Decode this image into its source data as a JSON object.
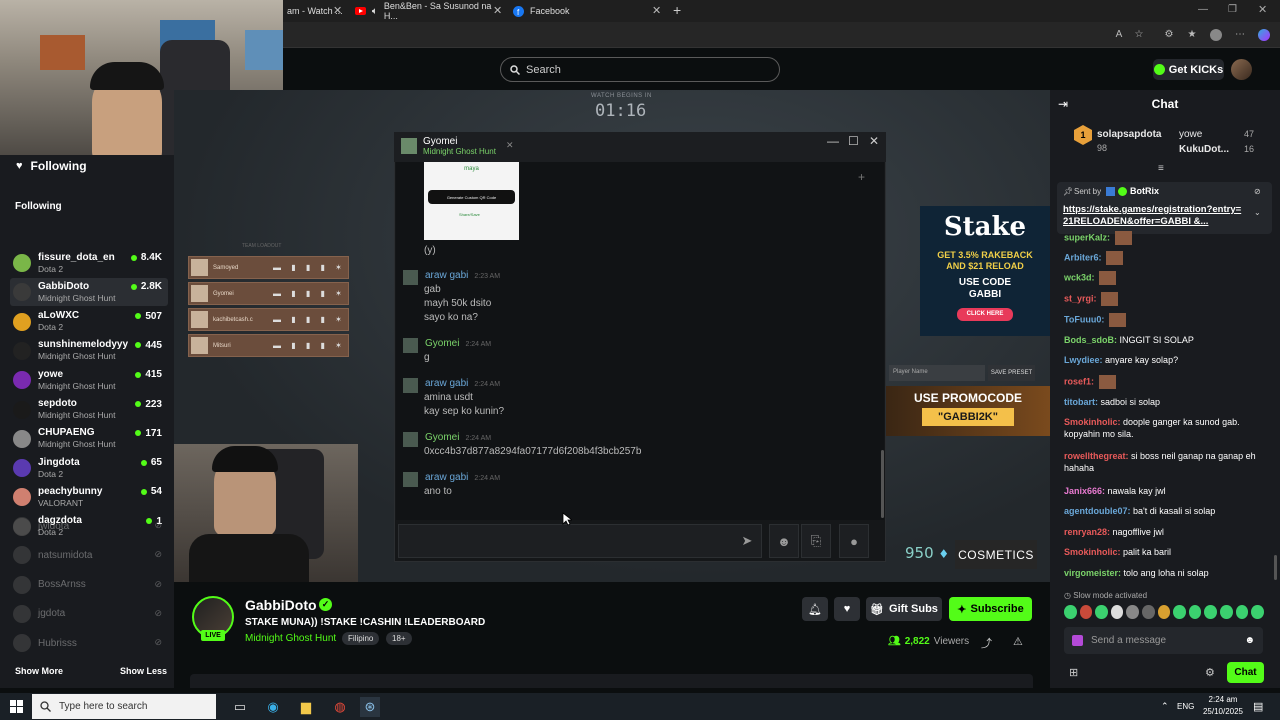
{
  "browser": {
    "tabs": [
      {
        "label": "am - Watch ...",
        "icon": "kick-icon"
      },
      {
        "label": "Ben&Ben - Sa Susunod na H...",
        "icon": "youtube-icon"
      },
      {
        "label": "Facebook",
        "icon": "facebook-icon"
      }
    ],
    "new_tab": "+"
  },
  "header": {
    "search_placeholder": "Search",
    "get_kicks": "Get KICKs"
  },
  "sidebar": {
    "following_header": "Following",
    "section_title": "Following",
    "channels": [
      {
        "name": "fissure_dota_en",
        "category": "Dota 2",
        "viewers": "8.4K",
        "color": "#7ab648"
      },
      {
        "name": "GabbiDoto",
        "category": "Midnight Ghost Hunt",
        "viewers": "2.8K",
        "color": "#3a3a3a"
      },
      {
        "name": "aLoWXC",
        "category": "Dota 2",
        "viewers": "507",
        "color": "#e0a020"
      },
      {
        "name": "sunshinemelodyyy",
        "category": "Midnight Ghost Hunt",
        "viewers": "445",
        "color": "#222"
      },
      {
        "name": "yowe",
        "category": "Midnight Ghost Hunt",
        "viewers": "415",
        "color": "#7a2ab0"
      },
      {
        "name": "sepdoto",
        "category": "Midnight Ghost Hunt",
        "viewers": "223",
        "color": "#1a1a1a"
      },
      {
        "name": "CHUPAENG",
        "category": "Midnight Ghost Hunt",
        "viewers": "171",
        "color": "#888"
      },
      {
        "name": "Jingdota",
        "category": "Dota 2",
        "viewers": "65",
        "color": "#5a3ab0"
      },
      {
        "name": "peachybunny",
        "category": "VALORANT",
        "viewers": "54",
        "color": "#d08070"
      },
      {
        "name": "dagzdota",
        "category": "Dota 2",
        "viewers": "1",
        "color": "#444"
      }
    ],
    "offline": [
      "jwldota",
      "natsumidota",
      "BossArnss",
      "jgdota",
      "Hubrisss"
    ],
    "show_more": "Show More",
    "show_less": "Show Less"
  },
  "stream_overlay": {
    "watch_label": "WATCH BEGINS IN",
    "timer": "01:16",
    "team_label": "TEAM LOADOUT",
    "team": [
      "Samoyed",
      "Gyomei",
      "kachibetcash.c",
      "Mitsuri"
    ]
  },
  "chat_window": {
    "user": "Gyomei",
    "status": "Midnight Ghost Hunt",
    "qr_button": "Generate Custom QR Code",
    "qr_brand": "maya",
    "messages": [
      {
        "name": "",
        "time": "",
        "lines": [
          "(y)"
        ],
        "color": "#bbb"
      },
      {
        "name": "araw gabi",
        "time": "2:23 AM",
        "lines": [
          "gab",
          "mayh 50k dsito",
          "sayo ko na?"
        ],
        "color": "#6aa7d8"
      },
      {
        "name": "Gyomei",
        "time": "2:24 AM",
        "lines": [
          "g"
        ],
        "color": "#7bd36a"
      },
      {
        "name": "araw gabi",
        "time": "2:24 AM",
        "lines": [
          "amina usdt",
          "kay sep ko kunin?"
        ],
        "color": "#6aa7d8"
      },
      {
        "name": "Gyomei",
        "time": "2:24 AM",
        "lines": [
          "0xcc4b37d877a8294fa07177d6f208b4f3bcb257b"
        ],
        "color": "#7bd36a"
      },
      {
        "name": "araw gabi",
        "time": "2:24 AM",
        "lines": [
          "ano to"
        ],
        "color": "#6aa7d8"
      }
    ]
  },
  "game_ui": {
    "stake_brand": "Stake",
    "stake_line1": "GET 3.5% RAKEBACK",
    "stake_line2": "AND $21 RELOAD",
    "stake_use": "USE CODE",
    "stake_code": "GABBI",
    "stake_click": "CLICK HERE",
    "promo_line1": "USE PROMOCODE",
    "promo_code": "\"GABBI2K\"",
    "preset_label": "SAVE PRESET",
    "player_name": "Player Name",
    "gold": "950",
    "cosmetics": "COSMETICS"
  },
  "stream_info": {
    "channel": "GabbiDoto",
    "live": "LIVE",
    "title": "STAKE MUNA)) !STAKE !CASHIN !LEADERBOARD",
    "category": "Midnight Ghost Hunt",
    "tags": [
      "Filipino",
      "18+"
    ],
    "gift_subs": "Gift Subs",
    "subscribe": "Subscribe",
    "viewers": "2,822",
    "viewers_label": "Viewers"
  },
  "chat": {
    "title": "Chat",
    "leaderboard": [
      {
        "name": "solapsapdota",
        "count": "98",
        "color": "#e8a03a"
      },
      {
        "name": "yowe",
        "count": "47",
        "color": "#bbb"
      },
      {
        "name": "KukuDot...",
        "count": "16",
        "color": "#e8a03a"
      }
    ],
    "pinned_by": "Sent by",
    "pinned_user": "BotRix",
    "pinned_link": "https://stake.games/registration?entry=21RELOADEN&offer=GABBI &...",
    "messages": [
      {
        "name": "superKalz:",
        "text": "",
        "color": "#7bd36a"
      },
      {
        "name": "Arbiter6:",
        "text": "",
        "color": "#6aa7d8"
      },
      {
        "name": "wck3d:",
        "text": "",
        "color": "#7bd36a"
      },
      {
        "name": "st_yrgi:",
        "text": "",
        "color": "#e85a5a"
      },
      {
        "name": "ToFuuu0:",
        "text": "",
        "color": "#6aa7d8"
      },
      {
        "name": "Bods_sdoB:",
        "text": "INGGIT SI SOLAP",
        "color": "#7bd36a"
      },
      {
        "name": "Lwydiee:",
        "text": "anyare kay solap?",
        "color": "#6aa7d8"
      },
      {
        "name": "rosef1:",
        "text": "",
        "color": "#e85a5a"
      },
      {
        "name": "titobart:",
        "text": "sadboi si solap",
        "color": "#6aa7d8"
      },
      {
        "name": "Smokinholic:",
        "text": "doople ganger ka sunod gab. kopyahin mo sila.",
        "color": "#e85a5a"
      },
      {
        "name": "rowellthegreat:",
        "text": "si boss neil ganap na ganap eh hahaha",
        "color": "#e85a5a"
      },
      {
        "name": "Janix666:",
        "text": "nawala kay jwl",
        "color": "#e87ad0"
      },
      {
        "name": "agentdouble07:",
        "text": "ba't di kasali si solap",
        "color": "#6aa7d8"
      },
      {
        "name": "renryan28:",
        "text": "nagofflive jwl",
        "color": "#e85a5a"
      },
      {
        "name": "Smokinholic:",
        "text": "palit ka baril",
        "color": "#e85a5a"
      },
      {
        "name": "virgomeister:",
        "text": "tolo ang loha ni solap",
        "color": "#7bd36a"
      }
    ],
    "slow_mode": "Slow mode activated",
    "input_placeholder": "Send a message",
    "send": "Chat"
  },
  "taskbar": {
    "search_placeholder": "Type here to search",
    "lang": "ENG",
    "time": "2:24 am",
    "date": "25/10/2025"
  }
}
